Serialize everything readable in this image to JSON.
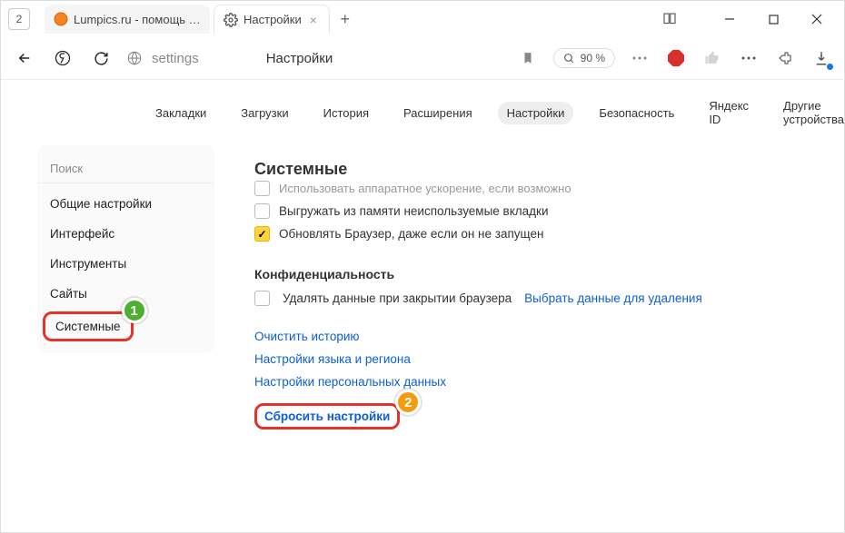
{
  "titlebar": {
    "tab_count": "2",
    "tabs": [
      {
        "label": "Lumpics.ru - помощь с ком",
        "active": false
      },
      {
        "label": "Настройки",
        "active": true
      }
    ]
  },
  "addressbar": {
    "url_path": "settings",
    "page_title": "Настройки",
    "zoom": "90 %"
  },
  "secnav": {
    "items": [
      "Закладки",
      "Загрузки",
      "История",
      "Расширения",
      "Настройки",
      "Безопасность",
      "Яндекс ID",
      "Другие устройства"
    ],
    "active_index": 4
  },
  "sidebar": {
    "search_placeholder": "Поиск",
    "items": [
      "Общие настройки",
      "Интерфейс",
      "Инструменты",
      "Сайты",
      "Системные"
    ],
    "highlight_index": 4
  },
  "content": {
    "heading": "Системные",
    "truncated_option": "Использовать аппаратное ускорение, если возможно",
    "checkboxes": [
      {
        "label": "Выгружать из памяти неиспользуемые вкладки",
        "checked": false
      },
      {
        "label": "Обновлять Браузер, даже если он не запущен",
        "checked": true
      }
    ],
    "privacy_heading": "Конфиденциальность",
    "privacy_checkbox": {
      "label": "Удалять данные при закрытии браузера",
      "checked": false
    },
    "privacy_link": "Выбрать данные для удаления",
    "links": [
      "Очистить историю",
      "Настройки языка и региона",
      "Настройки персональных данных",
      "Сбросить настройки"
    ],
    "highlight_link_index": 3
  },
  "annotations": {
    "badge1": "1",
    "badge2": "2"
  }
}
